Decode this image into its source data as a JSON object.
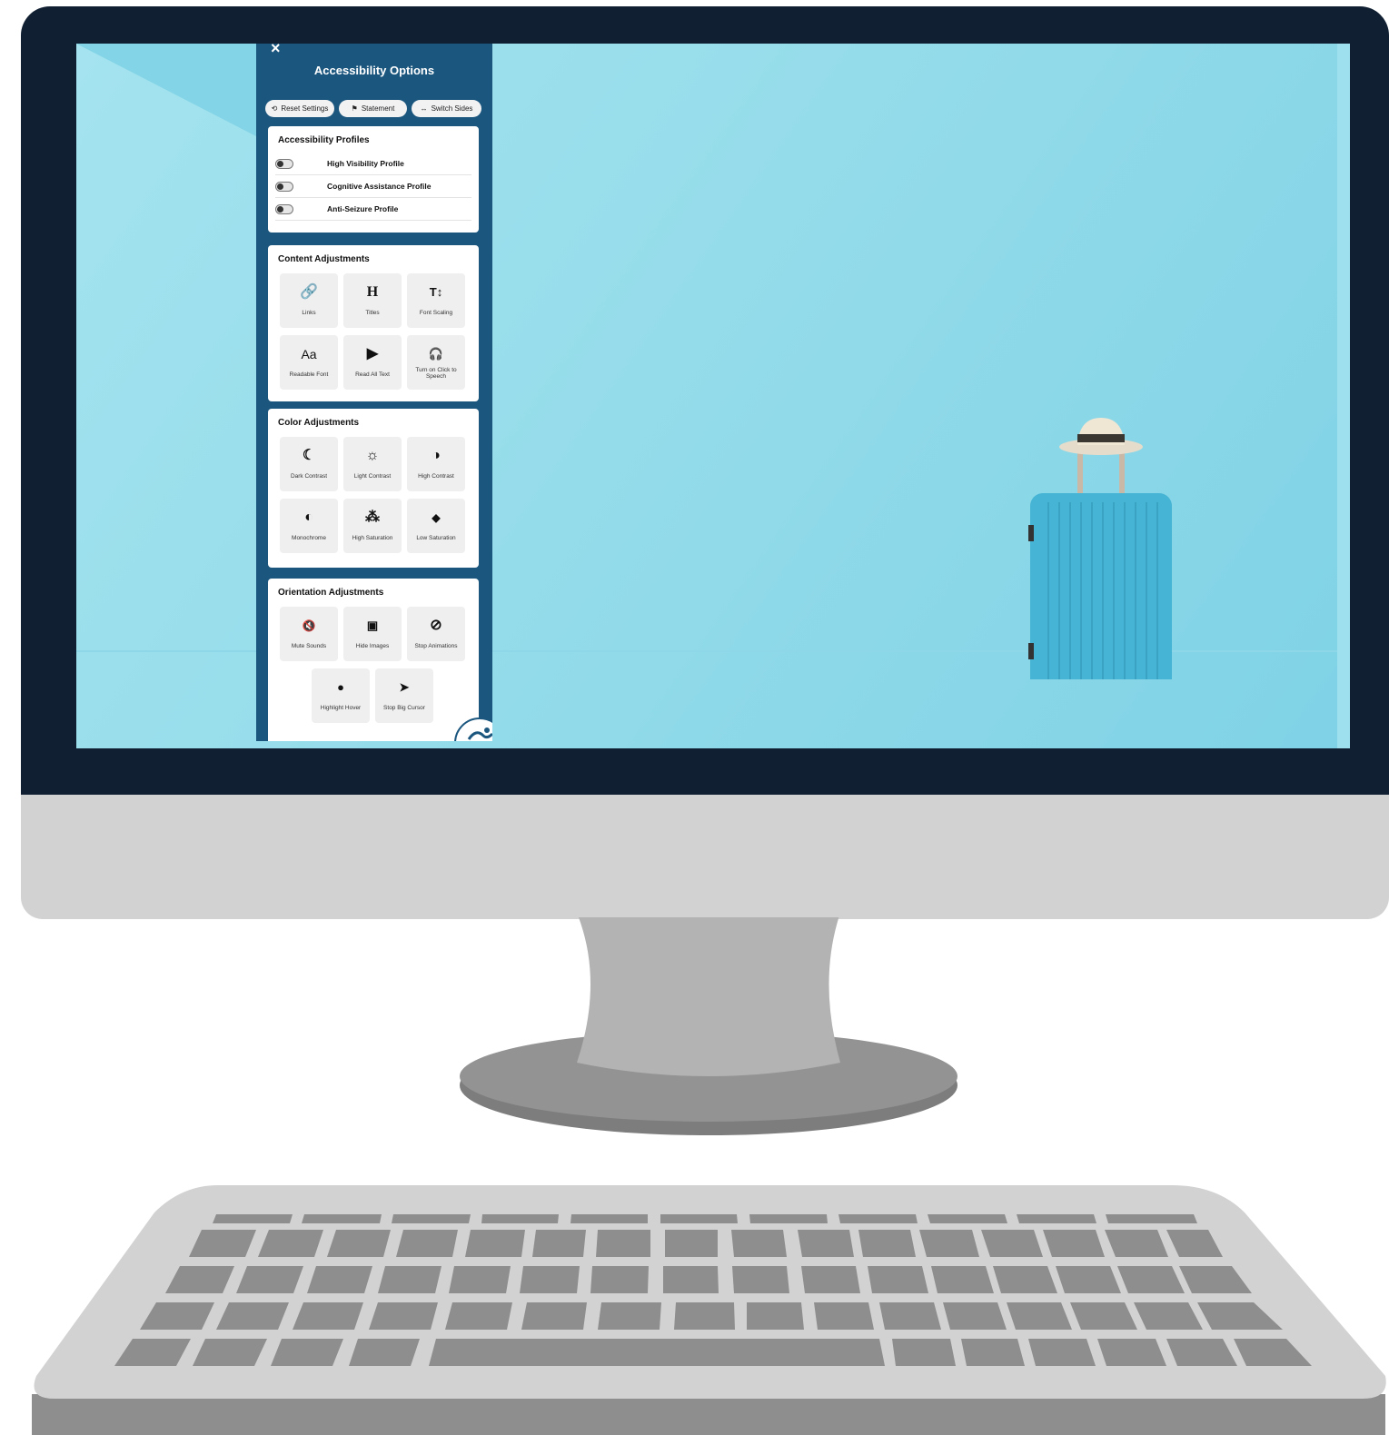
{
  "panel": {
    "title": "Accessibility Options",
    "close": "×",
    "top_buttons": [
      {
        "icon": "⟲",
        "label": "Reset Settings"
      },
      {
        "icon": "⚑",
        "label": "Statement"
      },
      {
        "icon": "↔",
        "label": "Switch Sides"
      }
    ],
    "profiles": {
      "title": "Accessibility Profiles",
      "items": [
        {
          "label": "High Visibility Profile",
          "on": false
        },
        {
          "label": "Cognitive Assistance Profile",
          "on": false
        },
        {
          "label": "Anti-Seizure Profile",
          "on": false
        }
      ]
    },
    "content": {
      "title": "Content Adjustments",
      "tiles": [
        {
          "icon": "🔗",
          "label": "Links"
        },
        {
          "icon": "H",
          "label": "Titles"
        },
        {
          "icon": "T↕",
          "label": "Font Scaling"
        },
        {
          "icon": "Aa",
          "label": "Readable Font"
        },
        {
          "icon": "▶",
          "label": "Read All Text"
        },
        {
          "icon": "🎧",
          "label": "Turn on Click to Speech"
        }
      ]
    },
    "color": {
      "title": "Color Adjustments",
      "tiles": [
        {
          "icon": "☾",
          "label": "Dark Contrast"
        },
        {
          "icon": "☼",
          "label": "Light Contrast"
        },
        {
          "icon": "◑",
          "label": "High Contrast"
        },
        {
          "icon": "◐",
          "label": "Monochrome"
        },
        {
          "icon": "⁂",
          "label": "High Saturation"
        },
        {
          "icon": "◆",
          "label": "Low Saturation"
        }
      ]
    },
    "orientation": {
      "title": "Orientation Adjustments",
      "tiles": [
        {
          "icon": "🔇",
          "label": "Mute Sounds"
        },
        {
          "icon": "▣",
          "label": "Hide Images"
        },
        {
          "icon": "⊘",
          "label": "Stop Animations"
        },
        {
          "icon": "●",
          "label": "Highlight Hover"
        },
        {
          "icon": "➤",
          "label": "Stop Big Cursor"
        }
      ]
    }
  },
  "colors": {
    "panel": "#1b567e",
    "bezel": "#101f31",
    "screen": "#95dcea",
    "chin": "#d2d2d2"
  }
}
